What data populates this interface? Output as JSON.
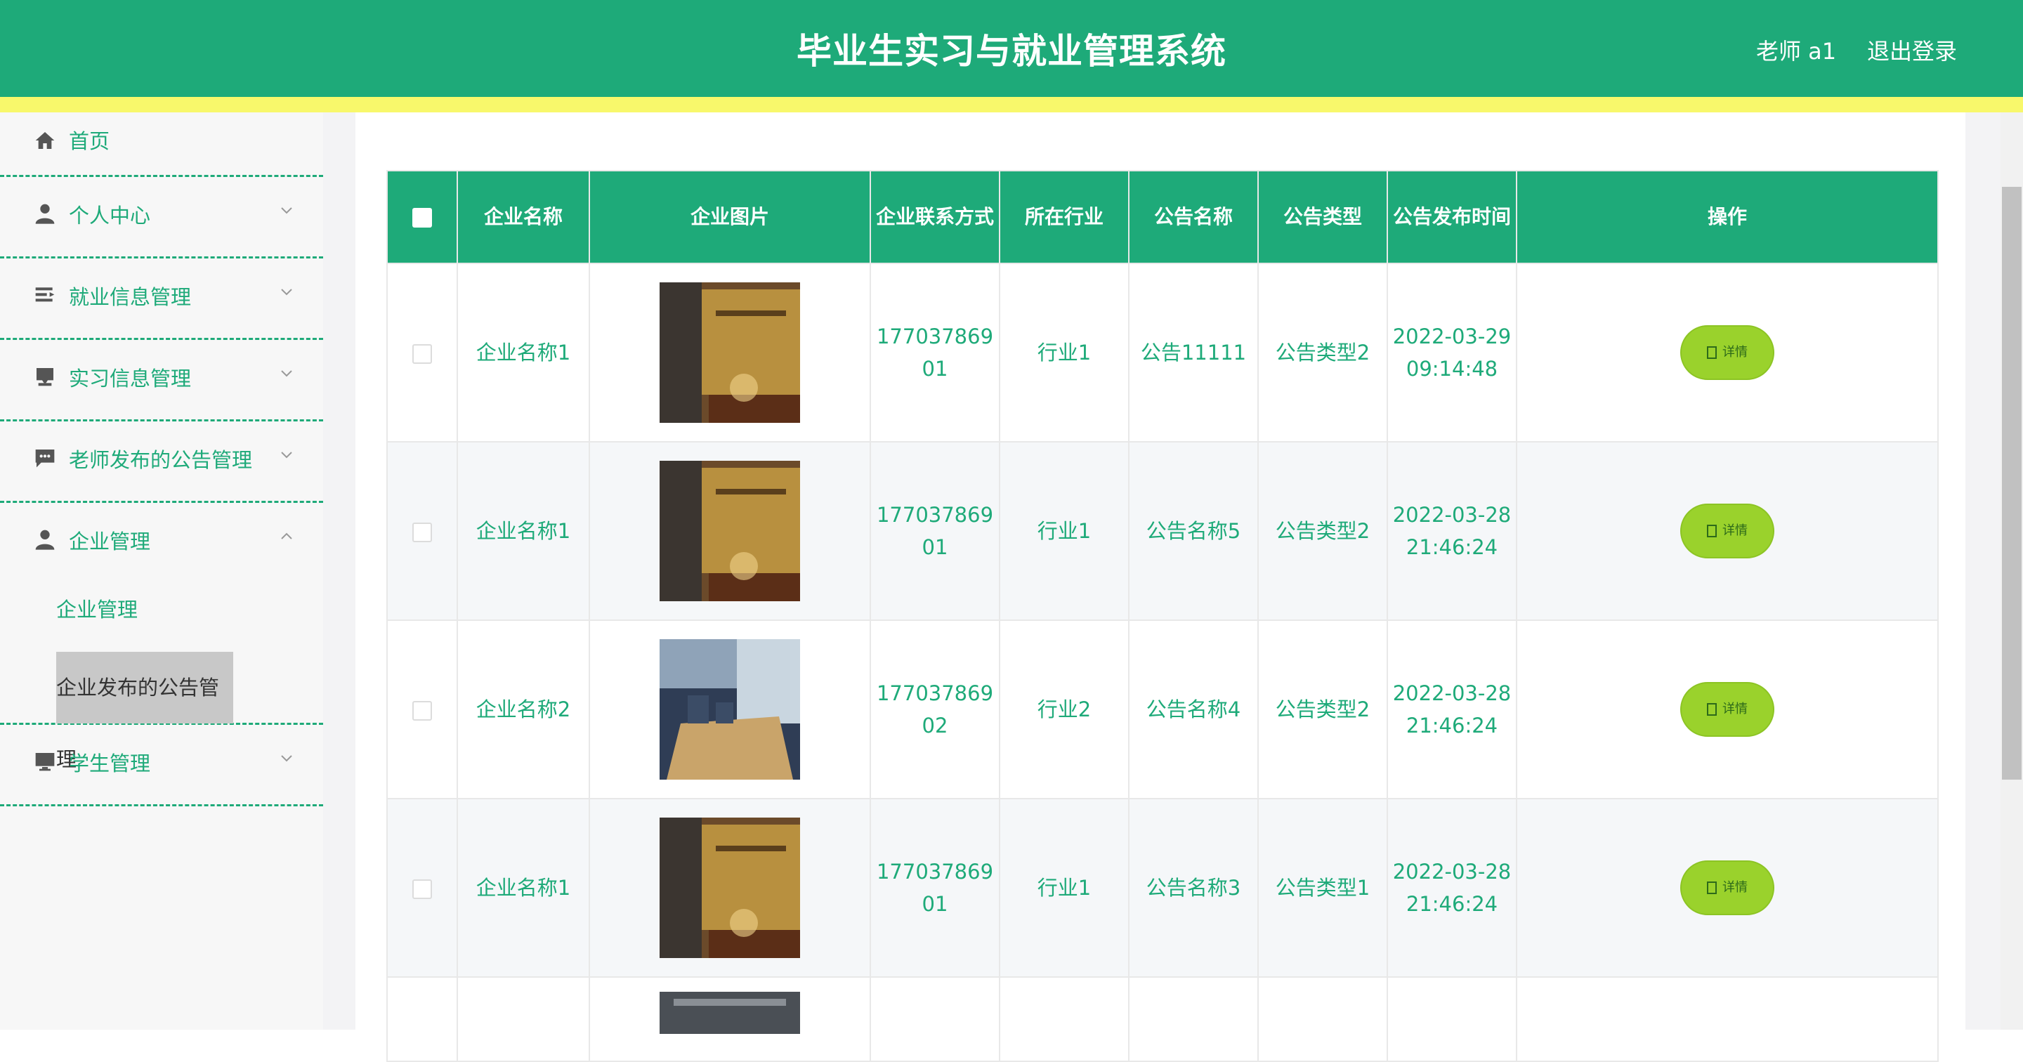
{
  "header": {
    "title": "毕业生实习与就业管理系统",
    "user": "老师 a1",
    "logout": "退出登录"
  },
  "sidebar": {
    "items": [
      {
        "label": "首页",
        "icon": "home-icon"
      },
      {
        "label": "个人中心",
        "icon": "user-icon"
      },
      {
        "label": "就业信息管理",
        "icon": "list-icon"
      },
      {
        "label": "实习信息管理",
        "icon": "inbox-icon"
      },
      {
        "label": "老师发布的公告管理",
        "icon": "chat-icon"
      },
      {
        "label": "企业管理",
        "icon": "user-icon"
      },
      {
        "label": "学生管理",
        "icon": "monitor-icon"
      }
    ],
    "submenu": [
      {
        "label": "企业管理"
      },
      {
        "label": "企业发布的公告管理",
        "active": true
      }
    ]
  },
  "table": {
    "columns": [
      "企业名称",
      "企业图片",
      "企业联系方式",
      "所在行业",
      "公告名称",
      "公告类型",
      "公告发布时间",
      "操作"
    ],
    "rows": [
      {
        "company": "企业名称1",
        "image": "lobby-photo",
        "phone": "17703786901",
        "industry": "行业1",
        "notice": "公告11111",
        "type": "公告类型2",
        "time": "2022-03-29 09:14:48",
        "action": "详情"
      },
      {
        "company": "企业名称1",
        "image": "lobby-photo",
        "phone": "17703786901",
        "industry": "行业1",
        "notice": "公告名称5",
        "type": "公告类型2",
        "time": "2022-03-28 21:46:24",
        "action": "详情"
      },
      {
        "company": "企业名称2",
        "image": "office-photo",
        "phone": "17703786902",
        "industry": "行业2",
        "notice": "公告名称4",
        "type": "公告类型2",
        "time": "2022-03-28 21:46:24",
        "action": "详情"
      },
      {
        "company": "企业名称1",
        "image": "lobby-photo",
        "phone": "17703786901",
        "industry": "行业1",
        "notice": "公告名称3",
        "type": "公告类型1",
        "time": "2022-03-28 21:46:24",
        "action": "详情"
      }
    ]
  },
  "colors": {
    "primary": "#1eaa79",
    "accent": "#f8f86b",
    "button": "#9ad22c"
  }
}
